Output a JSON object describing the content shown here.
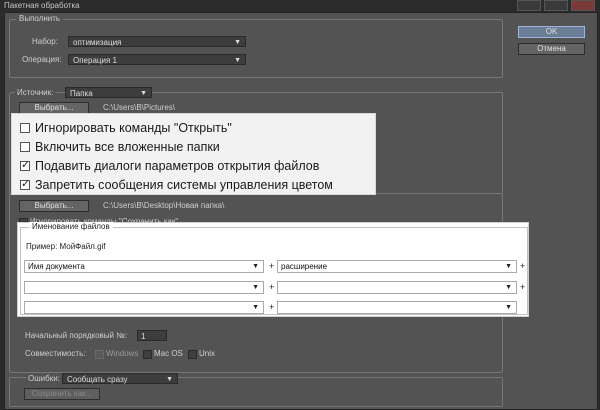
{
  "window": {
    "title": "Пакетная обработка"
  },
  "buttons": {
    "ok": "OK",
    "cancel": "Отмена"
  },
  "play": {
    "legend": "Выполнить",
    "set_label": "Набор:",
    "set_value": "оптимизация",
    "action_label": "Операция:",
    "action_value": "Операция 1"
  },
  "source": {
    "label": "Источник:",
    "value": "Папка",
    "choose": "Выбрать...",
    "path": "C:\\Users\\B\\Pictures\\"
  },
  "source_options": [
    {
      "label": "Игнорировать команды \"Открыть\"",
      "checked": false
    },
    {
      "label": "Включить все вложенные папки",
      "checked": false
    },
    {
      "label": "Подавить диалоги параметров открытия файлов",
      "checked": true
    },
    {
      "label": "Запретить сообщения системы управления цветом",
      "checked": true
    }
  ],
  "destination": {
    "choose": "Выбрать...",
    "path": "C:\\Users\\B\\Desktop\\Новая папка\\",
    "override_partial": "Игнорировать команды \"Сохранить как\""
  },
  "naming": {
    "legend": "Именование файлов",
    "example": "Пример: МойФайл.gif",
    "row1_left": "Имя документа",
    "row1_right": "расширение",
    "row2_left": "",
    "row2_right": "",
    "row3_left": "",
    "row3_right": "",
    "plus": "+"
  },
  "serial": {
    "label": "Начальный порядковый №:",
    "value": "1"
  },
  "compat": {
    "label": "Совместимость:",
    "windows": "Windows",
    "macos": "Mac OS",
    "unix": "Unix"
  },
  "errors": {
    "label": "Ошибки:",
    "value": "Сообщать сразу",
    "save_as": "Сохранить как..."
  }
}
